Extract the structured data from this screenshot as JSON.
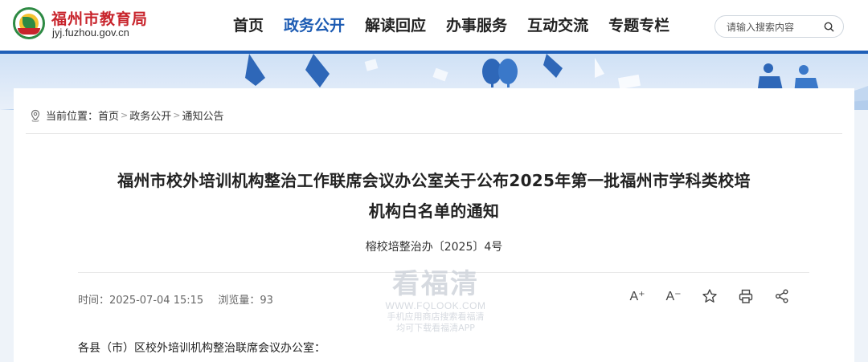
{
  "header": {
    "site_name": "福州市教育局",
    "site_domain": "jyj.fuzhou.gov.cn",
    "nav": [
      {
        "label": "首页",
        "active": false
      },
      {
        "label": "政务公开",
        "active": true
      },
      {
        "label": "解读回应",
        "active": false
      },
      {
        "label": "办事服务",
        "active": false
      },
      {
        "label": "互动交流",
        "active": false
      },
      {
        "label": "专题专栏",
        "active": false
      }
    ],
    "search": {
      "placeholder": "请输入搜索内容",
      "value": "",
      "icon": "search-icon"
    }
  },
  "colors": {
    "accent": "#1f5fb8",
    "brand_red": "#c8242c",
    "active_nav": "#1c5bb3"
  },
  "breadcrumb": {
    "prefix": "当前位置：",
    "items": [
      "首页",
      "政务公开",
      "通知公告"
    ],
    "separator": ">"
  },
  "article": {
    "title_line1": "福州市校外培训机构整治工作联席会议办公室关于公布2025年第一批福州市学科类校培",
    "title_line2": "机构白名单的通知",
    "doc_number": "榕校培整治办〔2025〕4号",
    "time_label": "时间：",
    "time_value": "2025-07-04 15:15",
    "views_label": "浏览量：",
    "views_value": "93",
    "greeting": "各县（市）区校外培训机构整治联席会议办公室："
  },
  "tools": {
    "font_up": "A⁺",
    "font_down": "A⁻",
    "favorite_icon": "star-icon",
    "print_icon": "print-icon",
    "share_icon": "share-icon"
  },
  "watermark": {
    "brand": "看福清",
    "url": "WWW.FQLOOK.COM",
    "line1": "手机应用商店搜索看福清",
    "line2": "均可下载看福清APP"
  }
}
